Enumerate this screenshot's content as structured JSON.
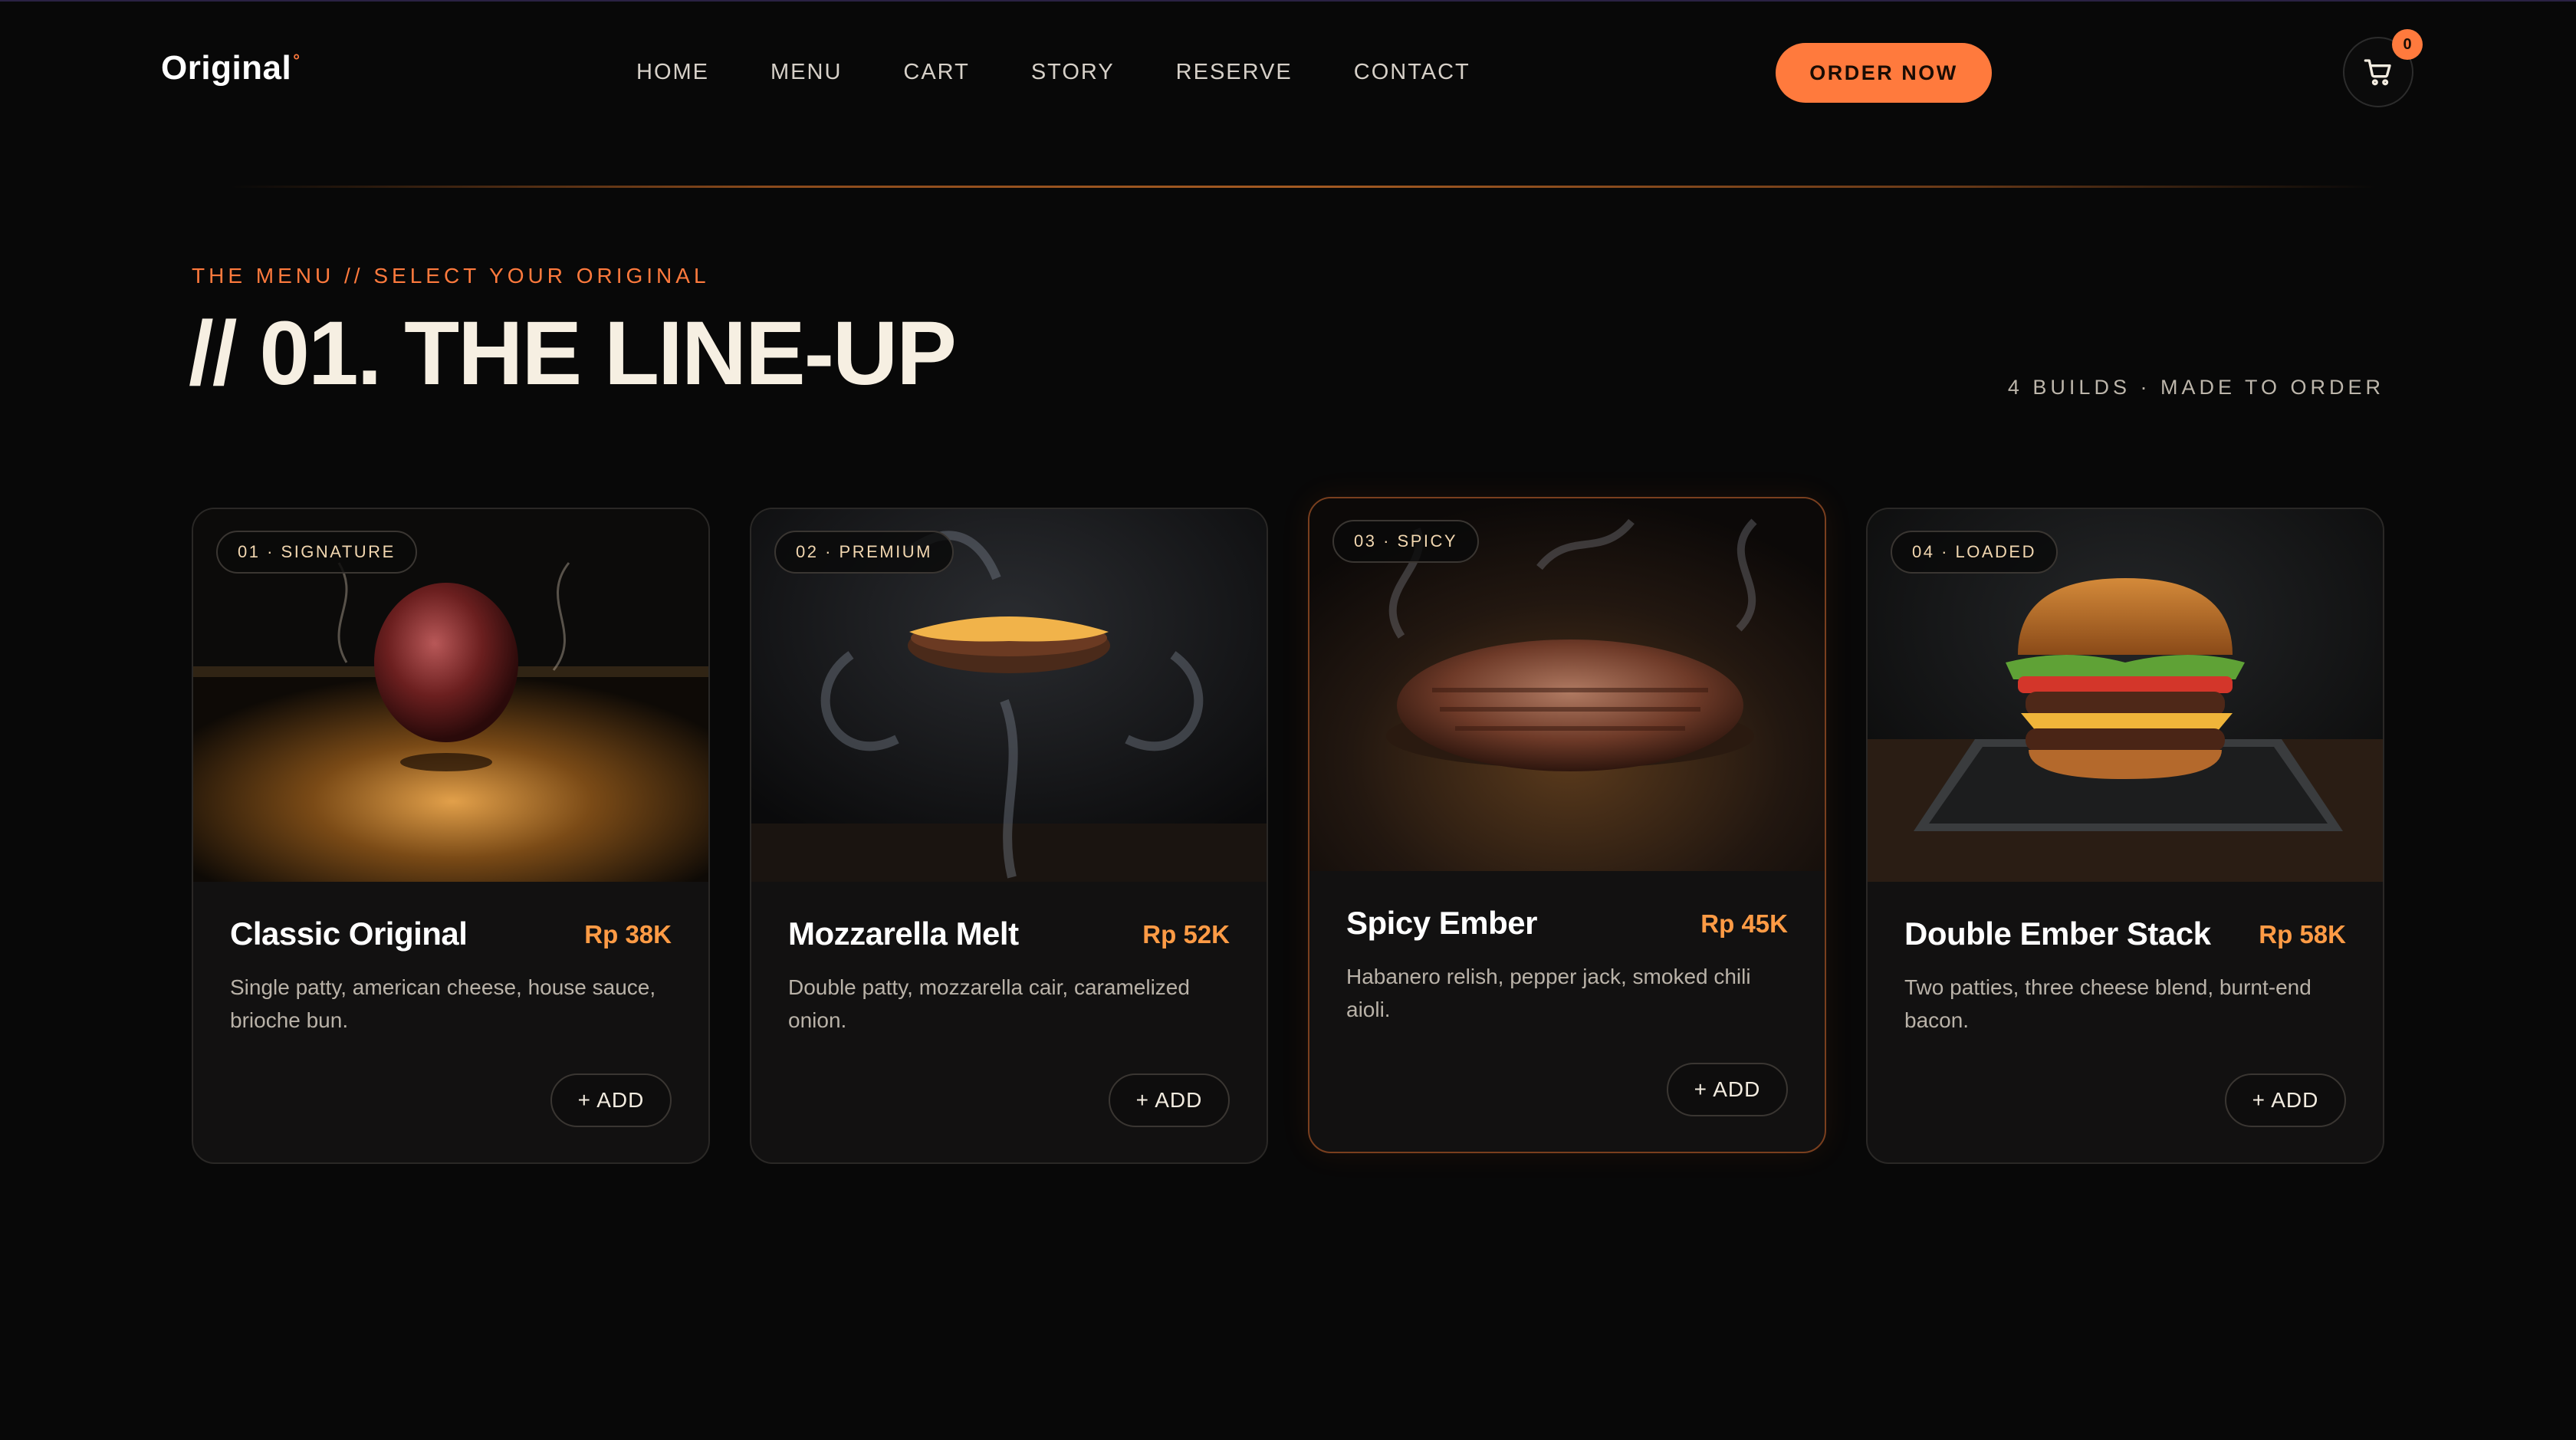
{
  "brand": {
    "name": "Original",
    "mark": "°"
  },
  "nav": {
    "links": [
      "HOME",
      "MENU",
      "CART",
      "STORY",
      "RESERVE",
      "CONTACT"
    ],
    "order_label": "ORDER NOW",
    "cart_count": "0",
    "cart_icon": "cart-icon"
  },
  "section": {
    "eyebrow": "THE MENU // SELECT YOUR ORIGINAL",
    "title": "// 01. THE LINE-UP",
    "meta": "4 BUILDS · MADE TO ORDER"
  },
  "colors": {
    "accent": "#ff7a3d",
    "price": "#ff9b45",
    "background": "#080808"
  },
  "menu": [
    {
      "tag": "01 · SIGNATURE",
      "name": "Classic Original",
      "price": "Rp 38K",
      "description": "Single patty, american cheese, house sauce, brioche bun.",
      "add_label": "+ ADD"
    },
    {
      "tag": "02 · PREMIUM",
      "name": "Mozzarella Melt",
      "price": "Rp 52K",
      "description": "Double patty, mozzarella cair, caramelized onion.",
      "add_label": "+ ADD"
    },
    {
      "tag": "03 · SPICY",
      "name": "Spicy Ember",
      "price": "Rp 45K",
      "description": "Habanero relish, pepper jack, smoked chili aioli.",
      "add_label": "+ ADD"
    },
    {
      "tag": "04 · LOADED",
      "name": "Double Ember Stack",
      "price": "Rp 58K",
      "description": "Two patties, three cheese blend, burnt-end bacon.",
      "add_label": "+ ADD"
    }
  ]
}
